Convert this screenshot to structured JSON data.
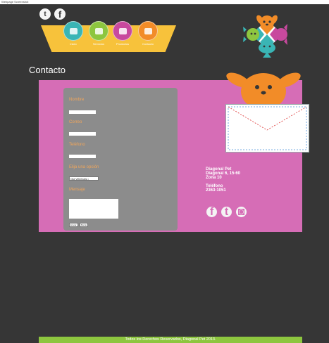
{
  "caption": "Webpage Screenshot",
  "social_top": [
    {
      "icon": "twitter-icon",
      "glyph": "t"
    },
    {
      "icon": "facebook-icon",
      "glyph": "f"
    }
  ],
  "nav": {
    "items": [
      {
        "label": "Inicio",
        "color": "#3ab5b5"
      },
      {
        "label": "Servicios",
        "color": "#8dc63f"
      },
      {
        "label": "Productos",
        "color": "#c8499e"
      },
      {
        "label": "Contacto",
        "color": "#f28c28"
      }
    ]
  },
  "page_title": "Contacto",
  "form": {
    "name_label": "Nombre",
    "email_label": "Correo",
    "phone_label": "Teléfono",
    "option_label": "Elija una opción",
    "select_value": "Cita Veterinaria  ↕",
    "message_label": "Mensaje",
    "send_button": "Enviar",
    "reset_button": "Borrar"
  },
  "contact": {
    "company": "Diagonal Pet",
    "address1": "Diagonal 6, 15-60",
    "address2": "Zona 10",
    "phone_label": "Teléfono",
    "phone": "2363-1051"
  },
  "social_bottom": [
    {
      "icon": "facebook-icon",
      "glyph": "f"
    },
    {
      "icon": "twitter-icon",
      "glyph": "t"
    },
    {
      "icon": "instagram-icon",
      "glyph": "◙"
    }
  ],
  "footer": "Todos los Derechos Reservados, Diagonal Pet 2013.",
  "colors": {
    "background": "#363636",
    "panel": "#d66db6",
    "form": "#8c8c8c",
    "label": "#f2a65a",
    "banner": "#f7c23b",
    "footer": "#8dc63f"
  }
}
